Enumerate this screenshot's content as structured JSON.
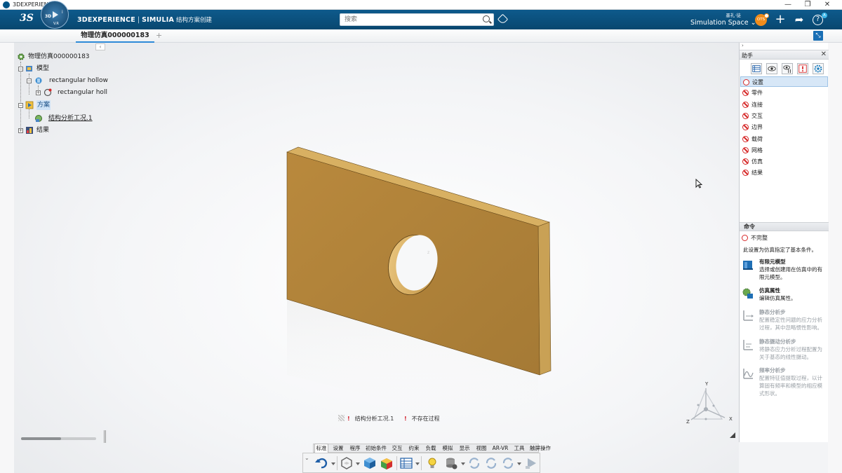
{
  "window": {
    "title": "3DEXPERIENCE",
    "minimize": "—",
    "restore": "❐",
    "close": "✕"
  },
  "header": {
    "logo_text": "3S",
    "compass": {
      "left_label": "3D",
      "bottom_label": "V.R",
      "right_label": "i"
    },
    "brand_main": "3DEXPERIENCE",
    "brand_sep": "|",
    "brand_app": "SIMULIA",
    "brand_sub": "结构方案创建",
    "search_placeholder": "搜索",
    "user_name": "墨礼·徒",
    "space_label": "Simulation Space",
    "space_caret": "⌄",
    "avatar_text": "OTS",
    "add_icon": "+",
    "share_icon": "➦",
    "help_icon": "?",
    "help_badge": "A"
  },
  "tabs": {
    "active": "物理仿真000000183",
    "add": "+"
  },
  "tree": {
    "root": "物理仿真000000183",
    "model": "模型",
    "part1": "rectangular hollow",
    "part2": "rectangular holl",
    "scheme": "方案",
    "case": "结构分析工况.1",
    "results": "结果",
    "collapse": "‹"
  },
  "status": {
    "item1": "结构分析工况.1",
    "item2": "不存在过程",
    "excl": "!"
  },
  "triad": {
    "y": "Y",
    "x": "X",
    "z": "Z"
  },
  "command_tabs": [
    "标准",
    "设置",
    "程序",
    "初始条件",
    "交互",
    "约束",
    "负载",
    "模拟",
    "显示",
    "视图",
    "AR-VR",
    "工具",
    "触屏操作"
  ],
  "active_command_tab": 0,
  "assistant": {
    "top": "›",
    "title": "助手",
    "close": "✕",
    "items": [
      "设置",
      "零件",
      "连接",
      "交互",
      "边界",
      "载荷",
      "网格",
      "仿真",
      "结果"
    ],
    "selected_index": 0,
    "commands_title": "命令",
    "status_label": "不完整",
    "status_desc": "此设置为仿真指定了基本条件。",
    "commands": [
      {
        "title": "有限元模型",
        "desc": "选择或创建用在仿真中的有限元模型。",
        "enabled": true
      },
      {
        "title": "仿真属性",
        "desc": "编辑仿真属性。",
        "enabled": true
      },
      {
        "title": "静态分析步",
        "desc": "配置稳定性问题的应力分析过程，其中忽略惯性影响。",
        "enabled": false
      },
      {
        "title": "静态摄动分析步",
        "desc": "将静态应力分析过程配置为关于基态的线性摄动。",
        "enabled": false
      },
      {
        "title": "频率分析步",
        "desc": "配置特征值提取过程，以计算固有频率和模型的相应模式形状。",
        "enabled": false
      }
    ]
  },
  "colors": {
    "header_bg": "#0b5080",
    "plate_face": "#b4873e",
    "plate_side": "#d4aa5c",
    "plate_edge": "#8a6428",
    "accent": "#2e8ad8",
    "error": "#d62828"
  }
}
